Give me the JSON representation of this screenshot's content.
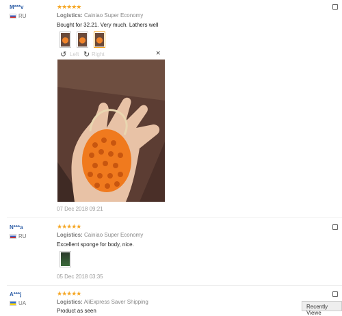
{
  "reviews": [
    {
      "name": "M***v",
      "country": "RU",
      "stars": "★★★★★",
      "logistics_label": "Logistics:",
      "logistics_value": "Cainiao Super Economy",
      "text": "Bought for 32.21. Very much. Lathers well",
      "date": "07 Dec 2018 09:21"
    },
    {
      "name": "N***a",
      "country": "RU",
      "stars": "★★★★★",
      "logistics_label": "Logistics:",
      "logistics_value": "Cainiao Super Economy",
      "text": "Excellent sponge for body, nice.",
      "date": "05 Dec 2018 03:35"
    },
    {
      "name": "A***j",
      "country": "UA",
      "stars": "★★★★★",
      "logistics_label": "Logistics:",
      "logistics_value": "AliExpress Saver Shipping",
      "text": "Product as seen"
    }
  ],
  "viewer": {
    "left_label": "Left",
    "right_label": "Right",
    "close_label": "×"
  },
  "recently_viewed": "Recently Viewe",
  "icons": {
    "rotate_left": "rotate-left-icon",
    "rotate_right": "rotate-right-icon",
    "close": "close-icon",
    "share": "share-icon"
  },
  "colors": {
    "star": "#f5a623",
    "name": "#2f5fa7"
  }
}
